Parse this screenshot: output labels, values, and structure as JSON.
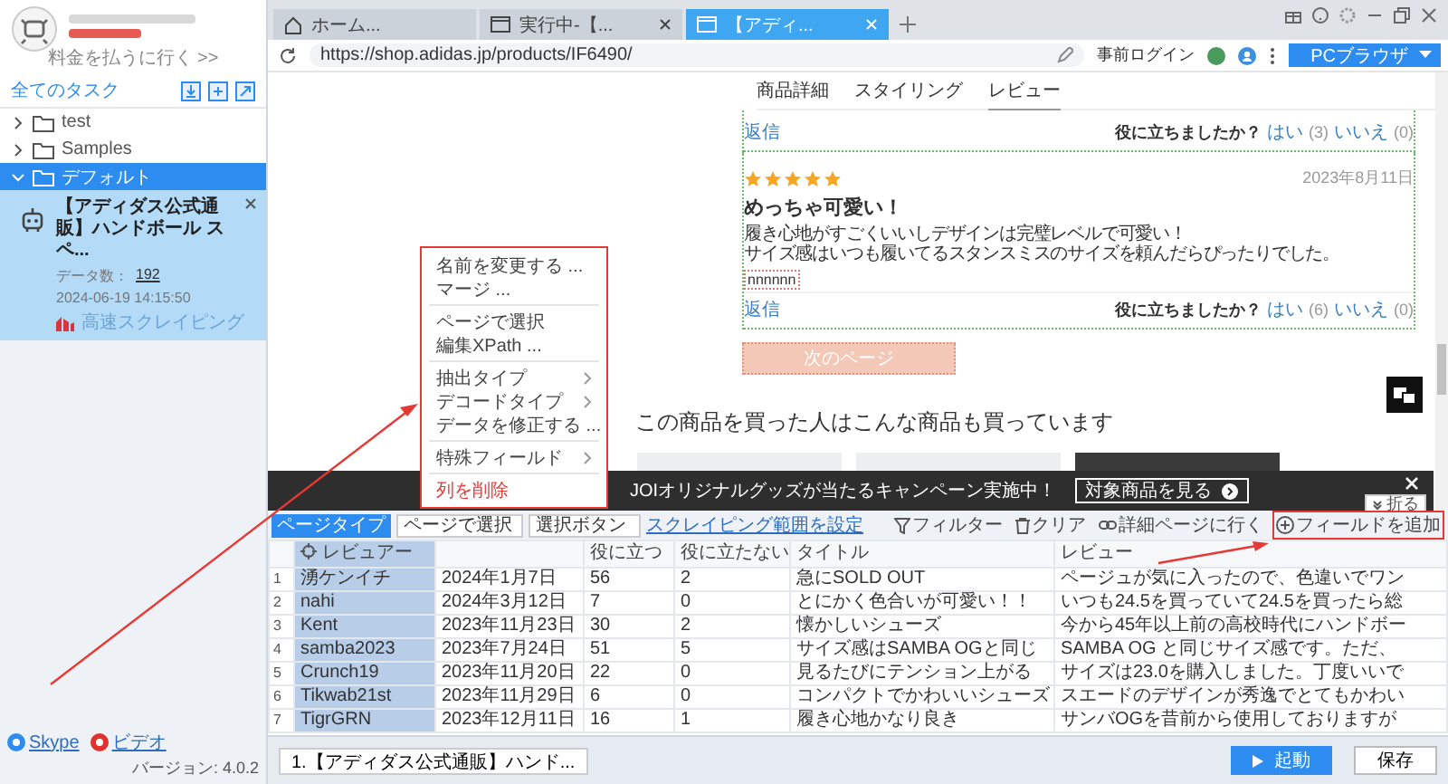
{
  "sidebar": {
    "billing_link": "料金を払うに行く >>",
    "section_title": "全てのタスク",
    "folders": [
      {
        "name": "test",
        "expanded": false,
        "selected": false
      },
      {
        "name": "Samples",
        "expanded": false,
        "selected": false
      },
      {
        "name": "デフォルト",
        "expanded": true,
        "selected": true,
        "children": [
          {
            "title": "【アディダス公式通販】ハンドボール スペ...",
            "data_label": "データ数：",
            "data_count": "192",
            "timestamp": "2024-06-19 14:15:50",
            "mode": "高速スクレイピング",
            "selected": true
          }
        ]
      }
    ],
    "footer": {
      "links": [
        "Skype",
        "ビデオ"
      ],
      "version": "バージョン: 4.0.2"
    }
  },
  "browser": {
    "tabs": [
      {
        "label": "ホーム...",
        "kind": "home",
        "selected": false,
        "closable": false
      },
      {
        "label": "実行中-【...",
        "kind": "page",
        "selected": false,
        "closable": true
      },
      {
        "label": "【アディ...",
        "kind": "page",
        "selected": true,
        "closable": true
      }
    ],
    "url": "https://shop.adidas.jp/products/IF6490/",
    "login": "事前ログイン",
    "mode_button": "PCブラウザ"
  },
  "page": {
    "nav": [
      {
        "label": "商品詳細",
        "selected": false
      },
      {
        "label": "スタイリング",
        "selected": false
      },
      {
        "label": "レビュー",
        "selected": true
      }
    ],
    "reviews": [
      {
        "reply": "返信",
        "question": "役に立ちましたか？",
        "yes": "はい",
        "yes_count": "(3)",
        "no": "いいえ",
        "no_count": "(0)"
      },
      {
        "stars": 5,
        "date": "2023年8月11日",
        "title": "めっちゃ可愛い！",
        "body": [
          "履き心地がすごくいいしデザインは完璧レベルで可愛い！",
          "サイズ感はいつも履いてるスタンスミスのサイズを頼んだらぴったりでした。"
        ],
        "tag": "nnnnnn",
        "reply": "返信",
        "question": "役に立ちましたか？",
        "yes": "はい",
        "yes_count": "(6)",
        "no": "いいえ",
        "no_count": "(0)"
      }
    ],
    "next_button": "次のページ",
    "recommend_title": "この商品を買った人はこんな商品も買っています",
    "banner": {
      "text": "JOIオリジナルグッズが当たるキャンペーン実施中！",
      "button": "対象商品を見る"
    },
    "collapse_button": "折る"
  },
  "context_menu": [
    [
      {
        "label": "名前を変更する ...",
        "kind": "action"
      },
      {
        "label": "マージ ...",
        "kind": "action"
      }
    ],
    [
      {
        "label": "ページで選択",
        "kind": "action"
      },
      {
        "label": "編集XPath ...",
        "kind": "action"
      }
    ],
    [
      {
        "label": "抽出タイプ",
        "kind": "submenu"
      },
      {
        "label": "デコードタイプ",
        "kind": "submenu"
      },
      {
        "label": "データを修正する ...",
        "kind": "action"
      }
    ],
    [
      {
        "label": "特殊フィールド",
        "kind": "submenu"
      }
    ],
    [
      {
        "label": "列を削除",
        "kind": "danger"
      }
    ]
  ],
  "toolbar": {
    "page_type": "ページタイプ",
    "page_select": "ページで選択",
    "button_select": "選択ボタン",
    "range_link": "スクレイピング範囲を設定",
    "actions": [
      {
        "label": "フィルター",
        "kind": "filter",
        "highlighted": false
      },
      {
        "label": "クリア",
        "kind": "trash",
        "highlighted": false
      },
      {
        "label": "詳細ページに行く",
        "kind": "link",
        "highlighted": false
      },
      {
        "label": "フィールドを追加",
        "kind": "add",
        "highlighted": true
      }
    ]
  },
  "table": {
    "columns": [
      {
        "label": "レビュアー",
        "selected": true
      },
      {
        "selected": false
      },
      {
        "label": "役に立つ",
        "selected": false
      },
      {
        "label": "役に立たない",
        "selected": false
      },
      {
        "label": "タイトル",
        "selected": false
      },
      {
        "label": "レビュー",
        "selected": false
      }
    ],
    "rows": [
      {
        "index": "1",
        "cells": [
          "湧ケンイチ",
          "2024年1月7日",
          "56",
          "2",
          "急にSOLD OUT",
          "ページュが気に入ったので、色違いでワン"
        ]
      },
      {
        "index": "2",
        "cells": [
          "nahi",
          "2024年3月12日",
          "7",
          "0",
          "とにかく色合いが可愛い！！",
          "いつも24.5を買っていて24.5を買ったら総"
        ]
      },
      {
        "index": "3",
        "cells": [
          "Kent",
          "2023年11月23日",
          "30",
          "2",
          "懐かしいシューズ",
          "今から45年以上前の高校時代にハンドボー"
        ]
      },
      {
        "index": "4",
        "cells": [
          "samba2023",
          "2023年7月24日",
          "51",
          "5",
          "サイズ感はSAMBA OGと同じ",
          "SAMBA OG と同じサイズ感です。ただ、"
        ]
      },
      {
        "index": "5",
        "cells": [
          "Crunch19",
          "2023年11月20日",
          "22",
          "0",
          "見るたびにテンション上がる",
          "サイズは23.0を購入しました。丁度いいで"
        ]
      },
      {
        "index": "6",
        "cells": [
          "Tikwab21st",
          "2023年11月29日",
          "6",
          "0",
          "コンパクトでかわいいシューズ",
          "スエードのデザインが秀逸でとてもかわい"
        ]
      },
      {
        "index": "7",
        "cells": [
          "TigrGRN",
          "2023年12月11日",
          "16",
          "1",
          "履き心地かなり良き",
          "サンバOGを昔前から使用しておりますが"
        ]
      }
    ]
  },
  "bottom_bar": {
    "task_tab": "1.【アディダス公式通販】ハンド...",
    "run_button": "起動",
    "save_button": "保存"
  }
}
